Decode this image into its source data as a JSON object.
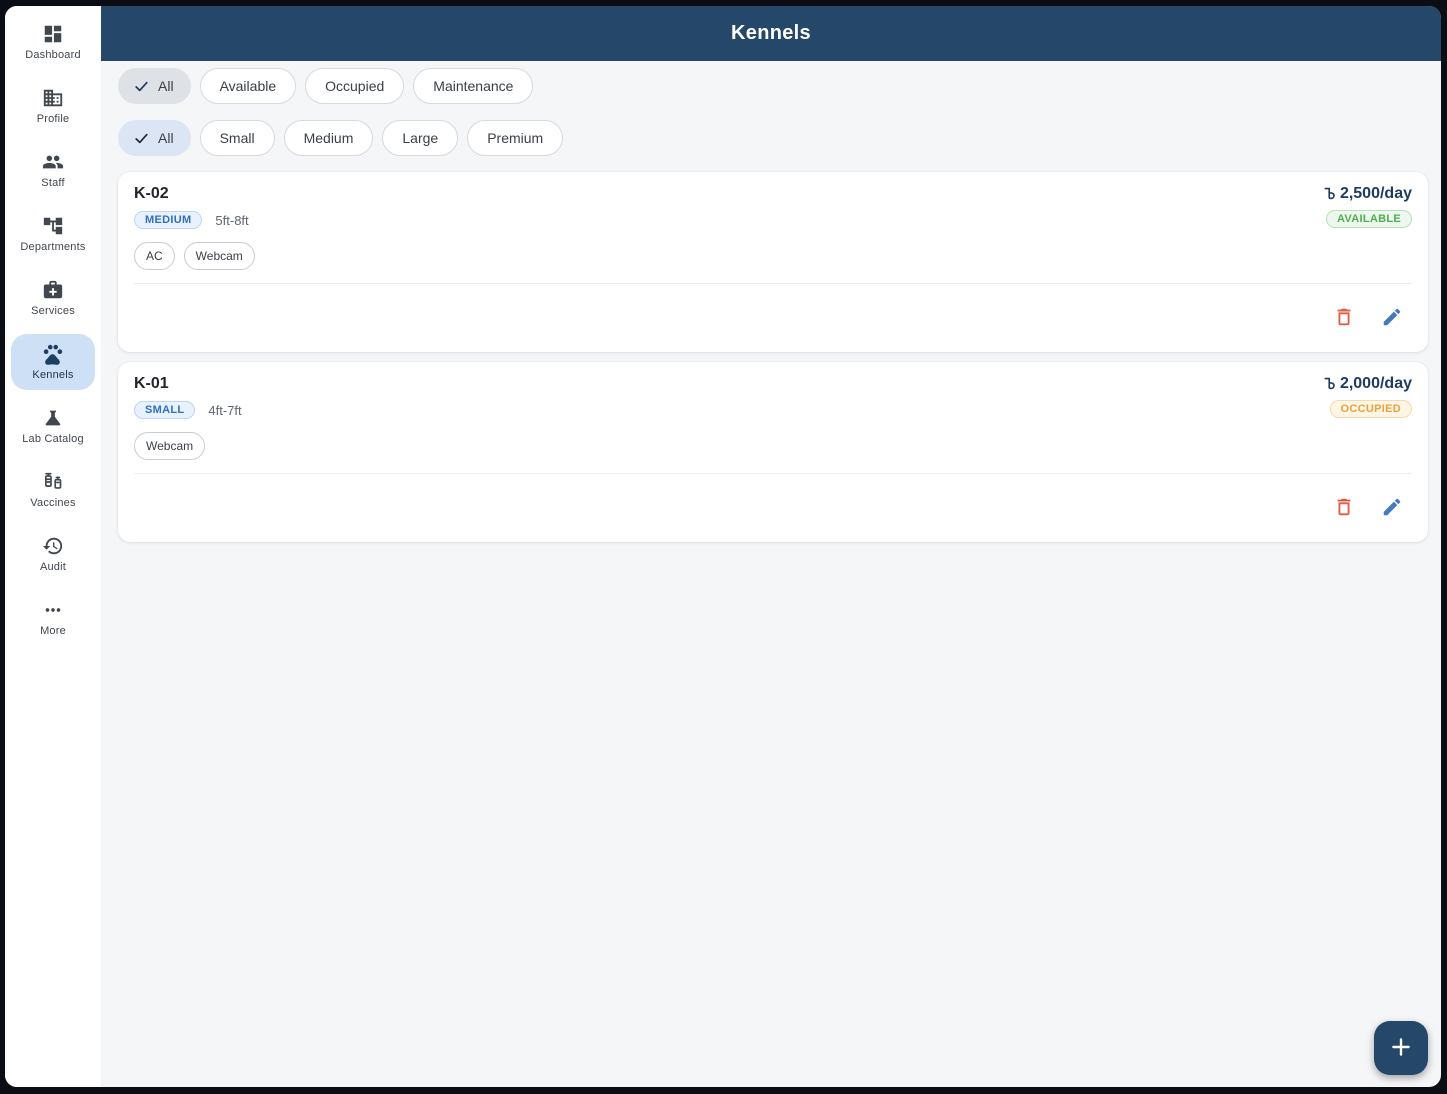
{
  "window": {
    "title": "Kennels"
  },
  "sidebar": {
    "items": [
      {
        "label": "Dashboard",
        "icon": "dashboard-icon",
        "selected": false
      },
      {
        "label": "Profile",
        "icon": "building-icon",
        "selected": false
      },
      {
        "label": "Staff",
        "icon": "people-icon",
        "selected": false
      },
      {
        "label": "Departments",
        "icon": "org-tree-icon",
        "selected": false
      },
      {
        "label": "Services",
        "icon": "medical-briefcase-icon",
        "selected": false
      },
      {
        "label": "Kennels",
        "icon": "paw-icon",
        "selected": true
      },
      {
        "label": "Lab Catalog",
        "icon": "flask-icon",
        "selected": false
      },
      {
        "label": "Vaccines",
        "icon": "syringe-vial-icon",
        "selected": false
      },
      {
        "label": "Audit",
        "icon": "history-icon",
        "selected": false
      },
      {
        "label": "More",
        "icon": "more-dots-icon",
        "selected": false
      }
    ]
  },
  "filters": {
    "status": {
      "selected": "All",
      "options": [
        "All",
        "Available",
        "Occupied",
        "Maintenance"
      ]
    },
    "size": {
      "selected": "All",
      "options": [
        "All",
        "Small",
        "Medium",
        "Large",
        "Premium"
      ]
    }
  },
  "kennels": [
    {
      "code": "K-02",
      "size": "MEDIUM",
      "dimensions": "5ft-8ft",
      "features": [
        "AC",
        "Webcam"
      ],
      "currency": "৳",
      "rate": "2,500/day",
      "status": "AVAILABLE"
    },
    {
      "code": "K-01",
      "size": "SMALL",
      "dimensions": "4ft-7ft",
      "features": [
        "Webcam"
      ],
      "currency": "৳",
      "rate": "2,000/day",
      "status": "OCCUPIED"
    }
  ],
  "fab": {
    "icon": "plus"
  },
  "colors": {
    "header_navy": "#254769",
    "nav_selected_bg": "#cde0f6",
    "size_badge_blue": "#2f6fc0",
    "available_green": "#4caf50",
    "occupied_amber": "#e8a33c",
    "delete_red": "#df5b45",
    "edit_blue": "#4579ba",
    "frame_black": "#0a0d13"
  }
}
